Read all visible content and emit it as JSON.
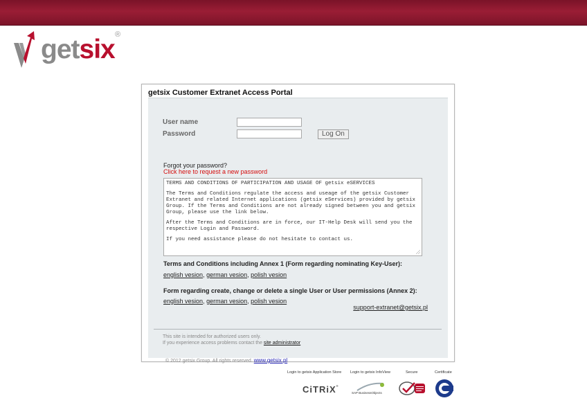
{
  "brand": {
    "name_part1": "get",
    "name_part2": "six",
    "registered": "®",
    "colors": {
      "topbar": "#8a1830",
      "brand_red": "#b8102e",
      "brand_gray": "#8a8a8a"
    }
  },
  "portal": {
    "title": "getsix Customer Extranet Access Portal",
    "username_label": "User name",
    "username_value": "",
    "password_label": "Password",
    "password_value": "",
    "logon_button": "Log On",
    "forgot_text": "Forgot your password?",
    "forgot_link": "Click here to request a new password",
    "terms": {
      "p1": "TERMS AND CONDITIONS OF PARTICIPATION AND USAGE OF getsix eSERVICES",
      "p2": "The Terms and Conditions regulate the access and useage of the getsix Customer Extranet and related Internet applications (getsix eServices) provided by getsix Group. If the Terms and Conditions are not already signed between you and getsix Group, please use the link below.",
      "p3": "After the Terms and Conditions are in force, our IT-Help Desk will send you the respective Login and Password.",
      "p4": "If you need assistance please do not hesitate to contact us."
    },
    "section1": {
      "title": "Terms and Conditions including Annex 1 (Form regarding nominating Key-User):",
      "links": [
        "english vesion",
        "german vesion",
        "polish vesion"
      ],
      "sep": ","
    },
    "section2": {
      "title": "Form regarding create, change or delete a single User or User permissions (Annex 2):",
      "links": [
        "english vesion",
        "german vesion",
        "polish vesion"
      ],
      "sep": ","
    },
    "support_email": "support-extranet@getsix.pl",
    "footer": {
      "line1": "This site is intended for authorized users only.",
      "line2_prefix": "If you experience access problems contact the",
      "admin_link": "site administrator",
      "copyright": "© 2012 getsix Group. All rights reserved.",
      "site_link": "www.getsix.pl"
    }
  },
  "badges": {
    "citrix_label": "Login to getsix Application Store",
    "citrix_logo": "CiTRiX",
    "citrix_tm": "®",
    "sap_label": "Login to getsix InfoView",
    "sap_logo": "SAP BusinessObjects",
    "secure_label": "Secure",
    "certificate_label": "Certificate",
    "secure_icon": "secure-checkmark-icon",
    "certificate_icon": "certificate-seal-icon"
  }
}
